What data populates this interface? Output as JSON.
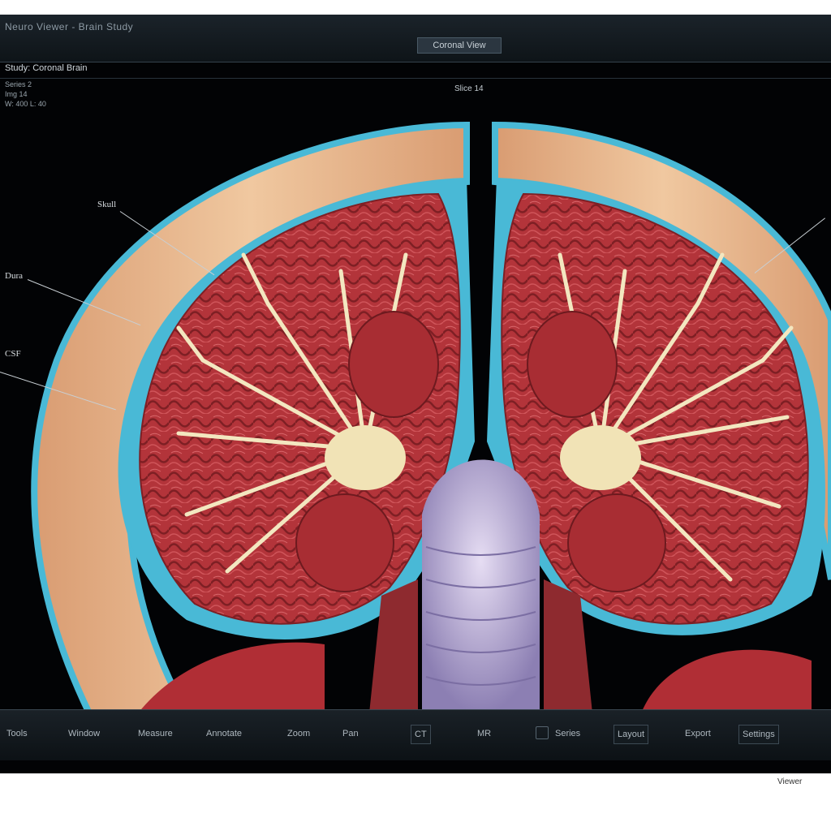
{
  "window": {
    "app_title": "Neuro Viewer - Brain Study",
    "tab_label": "Coronal View"
  },
  "study": {
    "label": "Study: Coronal Brain",
    "info_lines": [
      "Series 2",
      "Img 14",
      "W: 400 L: 40"
    ],
    "slice_label": "Slice 14"
  },
  "annotations": [
    "Skull",
    "Dura",
    "CSF"
  ],
  "toolbar": {
    "buttons": [
      "Tools",
      "Window",
      "Measure",
      "Annotate",
      "Zoom",
      "Pan",
      "CT",
      "MR",
      "Series",
      "Layout",
      "Export",
      "Settings"
    ]
  },
  "footer": {
    "corner_text": "Viewer"
  },
  "colors": {
    "brain_tissue": "#b8373a",
    "csf": "#49b9d6",
    "skull": "#e9b88f",
    "white_matter": "#f1e3b6",
    "brainstem": "#a99ac7"
  }
}
